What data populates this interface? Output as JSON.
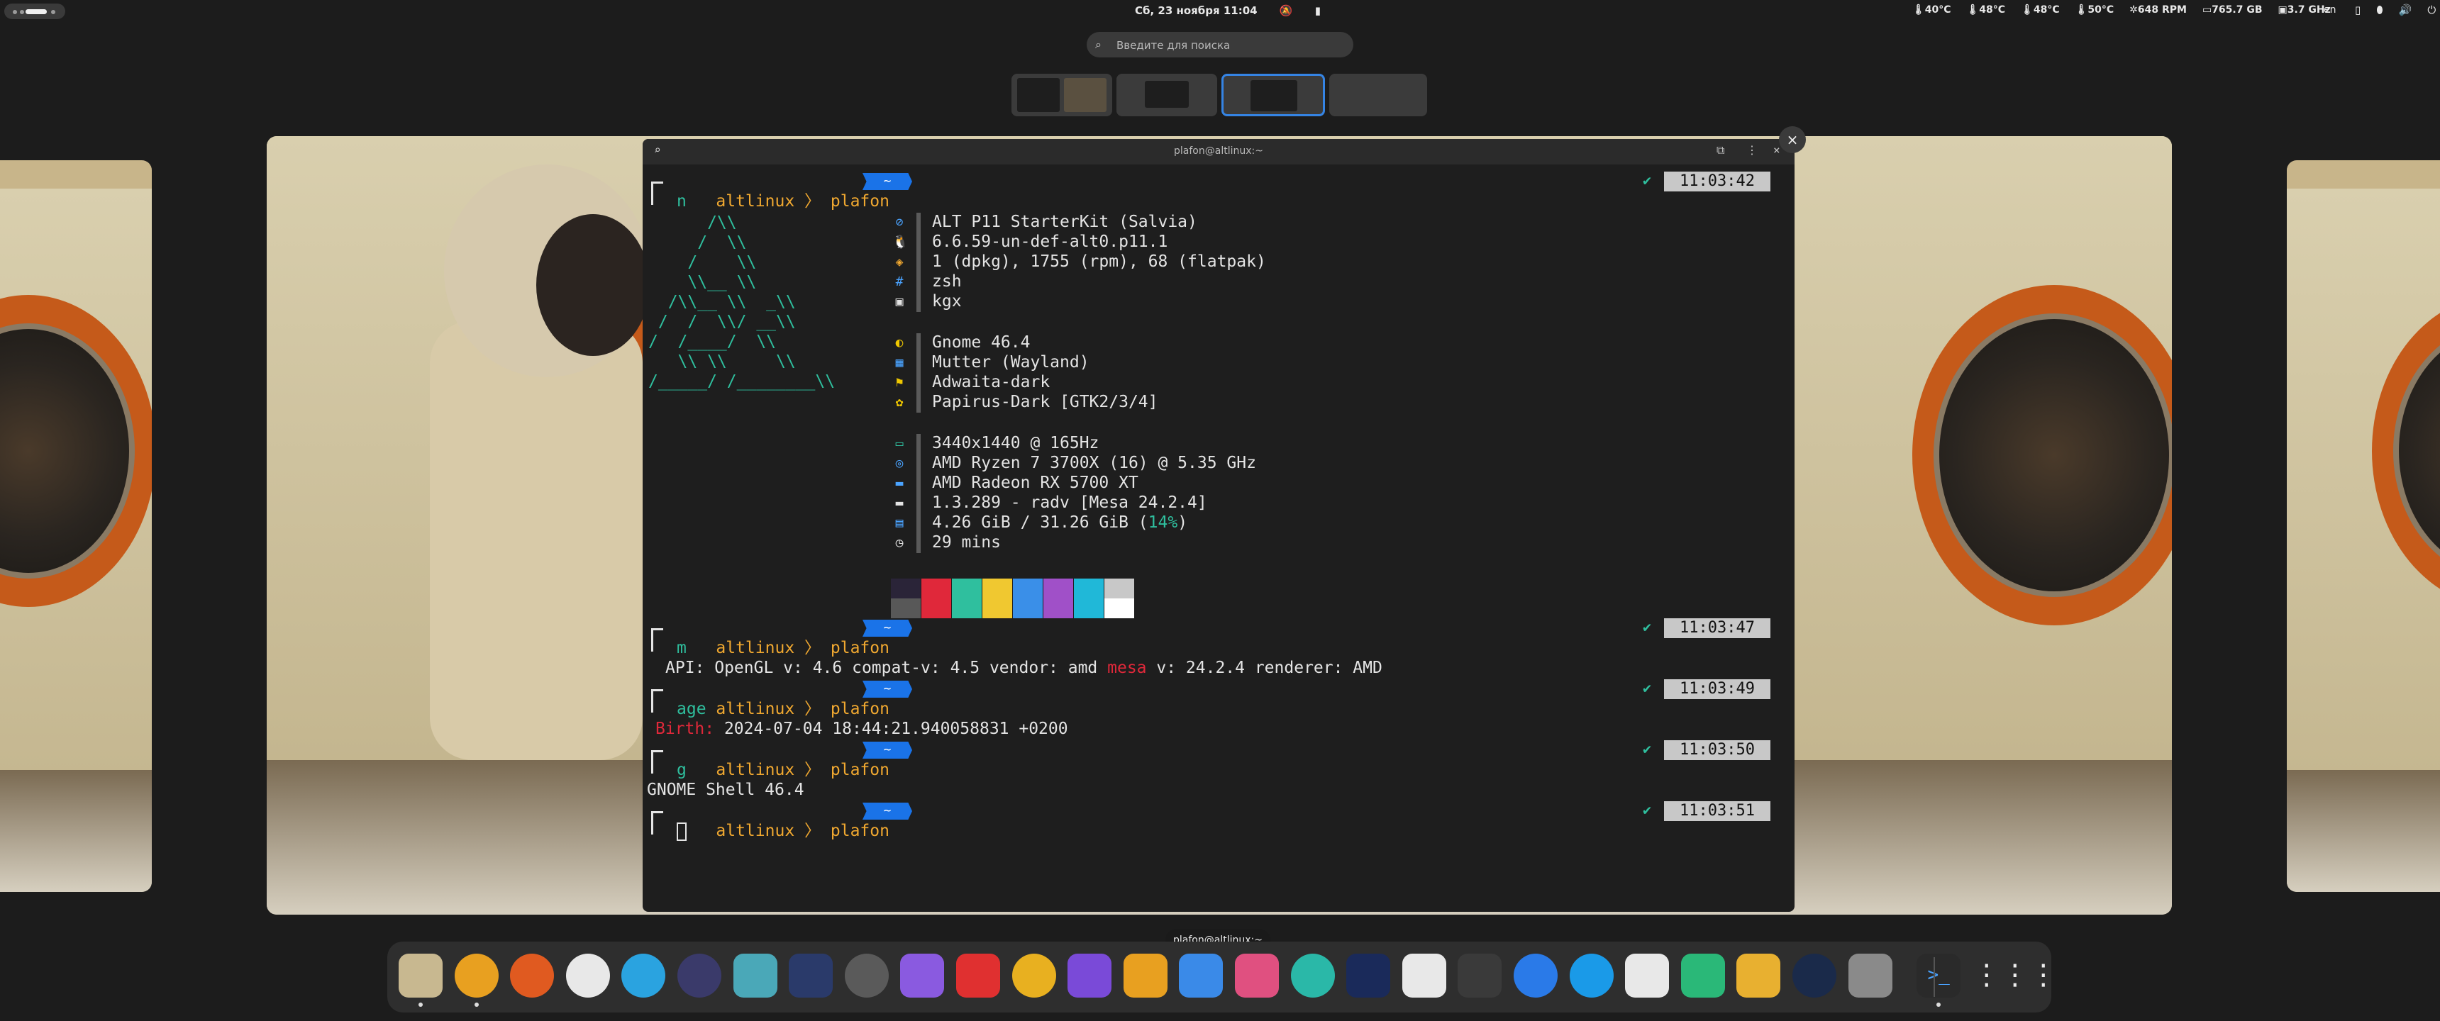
{
  "topbar": {
    "datetime": "Сб, 23 ноября 11:04",
    "bell": "🔕",
    "rec": "▮",
    "sensors": [
      "🌡40°C",
      "🌡48°C",
      "🌡48°C",
      "🌡50°C",
      "✲648 RPM",
      "▭765.7 GB",
      "▣3.7 GHz"
    ],
    "lang": "en",
    "sys": [
      "▯",
      "⬮",
      "🔊",
      "⏻"
    ]
  },
  "search": {
    "placeholder": "Введите для поиска",
    "icon": "search-icon"
  },
  "terminal": {
    "title": "plafon@altlinux:~",
    "prompt_user": "altlinux",
    "prompt_sep": "〉",
    "prompt_host": "plafon",
    "prompt_path": "~",
    "check": "✔",
    "times": [
      "11:03:42",
      "11:03:47",
      "11:03:49",
      "11:03:50",
      "11:03:51"
    ],
    "cmds": [
      "n",
      "m",
      "age",
      "g"
    ],
    "logo": "      /\\\\\n     /  \\\\\n    /    \\\\\n    \\\\__ \\\\\n  /\\\\__ \\\\  _\\\\\n /  /  \\\\/ __\\\\\n/  /____/  \\\\\n   \\\\ \\\\     \\\\\n/_____/ /________\\\\",
    "info": [
      {
        "icon": "⊘",
        "color": "#4aa3ff",
        "text": "ALT P11 StarterKit (Salvia)"
      },
      {
        "icon": "🐧",
        "color": "#e4e4e4",
        "text": "6.6.59-un-def-alt0.p11.1"
      },
      {
        "icon": "◈",
        "color": "#f0a830",
        "text": "1 (dpkg), 1755 (rpm), 68 (flatpak)"
      },
      {
        "icon": "#",
        "color": "#4aa3ff",
        "text": "zsh"
      },
      {
        "icon": "▣",
        "color": "#e4e4e4",
        "text": "kgx"
      },
      {
        "icon": "◐",
        "color": "#f0c800",
        "text": "Gnome 46.4"
      },
      {
        "icon": "▦",
        "color": "#4aa3ff",
        "text": "Mutter (Wayland)"
      },
      {
        "icon": "⚑",
        "color": "#f0c800",
        "text": "Adwaita-dark"
      },
      {
        "icon": "✿",
        "color": "#f0c800",
        "text": "Papirus-Dark [GTK2/3/4]"
      },
      {
        "icon": "▭",
        "color": "#2fbf9e",
        "text": "3440x1440 @ 165Hz"
      },
      {
        "icon": "◎",
        "color": "#4aa3ff",
        "text": "AMD Ryzen 7 3700X (16) @ 5.35 GHz"
      },
      {
        "icon": "▬",
        "color": "#4aa3ff",
        "text": "AMD Radeon RX 5700 XT"
      },
      {
        "icon": "▬",
        "color": "#e4e4e4",
        "text": "1.3.289 - radv [Mesa 24.2.4]"
      },
      {
        "icon": "▤",
        "color": "#4aa3ff",
        "text": "4.26 GiB / 31.26 GiB ("
      },
      {
        "icon": "◷",
        "color": "#e4e4e4",
        "text": "29 mins"
      }
    ],
    "mem_pct": "14%",
    "mem_close": ")",
    "colors_top": [
      "#2a2438",
      "#e0283a",
      "#2fbf9e",
      "#f0c830",
      "#3a8fe8",
      "#a050c8",
      "#20b8d8",
      "#c8c8c8"
    ],
    "colors_bottom": [
      "#585858",
      "#e0283a",
      "#2fbf9e",
      "#f0c830",
      "#3a8fe8",
      "#a050c8",
      "#20b8d8",
      "#ffffff"
    ],
    "gl_prefix": "API: OpenGL v: 4.6 compat-v: 4.5 vendor: amd ",
    "gl_mesa": "mesa",
    "gl_suffix": " v: 24.2.4 renderer: AMD",
    "birth_label": "Birth:",
    "birth_value": " 2024-07-04 18:44:21.940058831 +0200",
    "gnome_version": "GNOME Shell 46.4"
  },
  "tooltip": "plafon@altlinux:~",
  "dock": {
    "apps": [
      {
        "name": "files",
        "color": "#c8b890"
      },
      {
        "name": "chrome",
        "color": "#e8a020"
      },
      {
        "name": "firefox",
        "color": "#e05a20"
      },
      {
        "name": "yandex",
        "color": "#e8e8e8"
      },
      {
        "name": "telegram",
        "color": "#2aa3e0"
      },
      {
        "name": "davinci",
        "color": "#3a3a6a"
      },
      {
        "name": "scanner",
        "color": "#4aa8b8"
      },
      {
        "name": "audio",
        "color": "#2a3a6a"
      },
      {
        "name": "clock",
        "color": "#5a5a5a"
      },
      {
        "name": "screenshot",
        "color": "#8a5ae0"
      },
      {
        "name": "downloader",
        "color": "#e03030"
      },
      {
        "name": "color-picker",
        "color": "#e8b020"
      },
      {
        "name": "obsidian",
        "color": "#7a4ad8"
      },
      {
        "name": "text-editor",
        "color": "#e8a020"
      },
      {
        "name": "storage",
        "color": "#3a8ae8"
      },
      {
        "name": "diamond",
        "color": "#e05080"
      },
      {
        "name": "dbeaver",
        "color": "#2ab8a8"
      },
      {
        "name": "arrow",
        "color": "#1a2a5a"
      },
      {
        "name": "split",
        "color": "#e8e8e8"
      },
      {
        "name": "crop",
        "color": "#3a3a3a"
      },
      {
        "name": "zoom",
        "color": "#2a7ae8"
      },
      {
        "name": "skype",
        "color": "#1a9ae8"
      },
      {
        "name": "box",
        "color": "#e8e8e8"
      },
      {
        "name": "reader",
        "color": "#2ab878"
      },
      {
        "name": "sunny",
        "color": "#e8b030"
      },
      {
        "name": "gauge",
        "color": "#1a2a4a"
      },
      {
        "name": "security",
        "color": "#8a8a8a"
      },
      {
        "name": "terminal",
        "color": "#2a2a2a"
      },
      {
        "name": "app-grid",
        "color": "#2e2e2e"
      }
    ]
  }
}
